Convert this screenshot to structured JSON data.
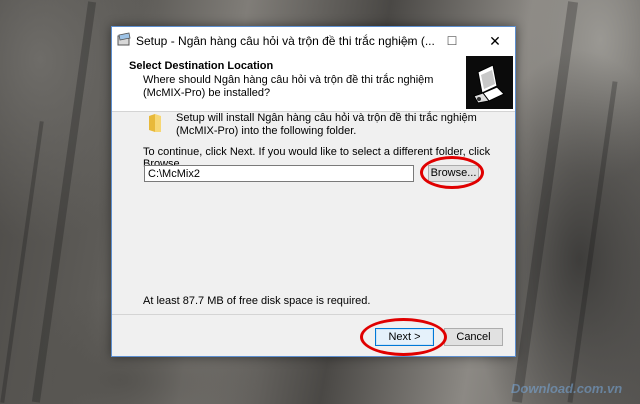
{
  "window": {
    "title": "Setup - Ngân hàng câu hỏi và trộn đề thi trắc nghiệm (...",
    "controls": {
      "minimize": "—",
      "maximize": "☐",
      "close": "✕"
    }
  },
  "header": {
    "title": "Select Destination Location",
    "subtitle": "Where should Ngân hàng câu hỏi và trộn đề thi trắc nghiệm (McMIX-Pro) be installed?"
  },
  "body": {
    "install_text": "Setup will install Ngân hàng câu hỏi và trộn đề thi trắc nghiệm (McMIX-Pro) into the following folder.",
    "continue_text": "To continue, click Next. If you would like to select a different folder, click Browse.",
    "path_value": "C:\\McMix2",
    "browse_label": "Browse...",
    "disk_text": "At least 87.7 MB of free disk space is required."
  },
  "footer": {
    "next_label": "Next >",
    "cancel_label": "Cancel"
  },
  "watermark": "Download.com.vn",
  "colors": {
    "highlight": "#e00000",
    "accent": "#0078d7"
  }
}
